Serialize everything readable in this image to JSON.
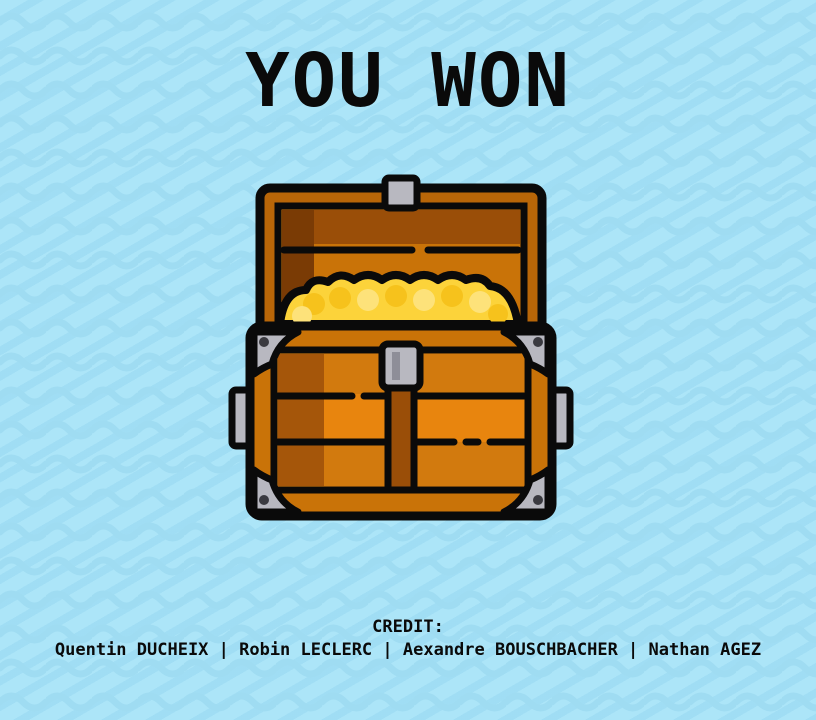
{
  "screen": {
    "title": "YOU WON",
    "chest_icon": "treasure-chest-icon"
  },
  "credits": {
    "heading": "CREDIT:",
    "names": "Quentin DUCHEIX | Robin LECLERC | Aexandre BOUSCHBACHER | Nathan AGEZ"
  },
  "colors": {
    "background": "#ace5f8",
    "wood_light": "#f08c10",
    "wood_mid": "#d27a0e",
    "wood_dark": "#9a4e08",
    "metal": "#b8b8c0",
    "gold": "#fcd33a",
    "outline": "#0a0a0a"
  }
}
